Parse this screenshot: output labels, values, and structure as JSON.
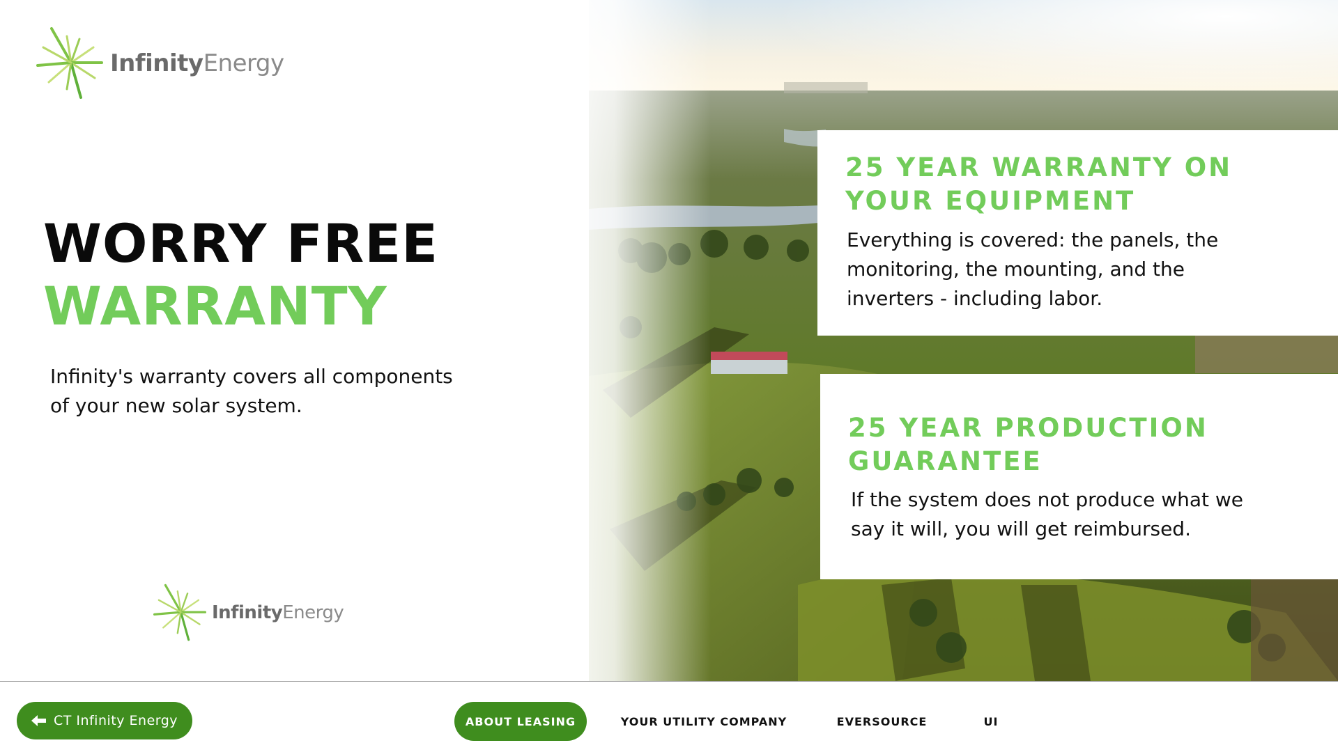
{
  "brand": {
    "logo_bold": "Infinity",
    "logo_light": "Energy",
    "accent_green": "#72cc5a",
    "button_green": "#3f8d1e"
  },
  "hero": {
    "headline_line1": "WORRY FREE",
    "headline_line2": "WARRANTY",
    "intro": "Infinity's warranty covers all components of your new solar system."
  },
  "cards": [
    {
      "title": "25 YEAR WARRANTY ON YOUR EQUIPMENT",
      "body": "Everything is covered: the panels, the monitoring, the mounting, and the inverters - including labor."
    },
    {
      "title": "25 YEAR PRODUCTION GUARANTEE",
      "body": "If the system does not produce what we say it will, you will get reimbursed."
    }
  ],
  "nav": {
    "back_label": "CT Infinity Energy",
    "back_icon": "arrow-left-icon",
    "items": [
      {
        "label": "ABOUT LEASING",
        "active": true
      },
      {
        "label": "YOUR UTILITY COMPANY",
        "active": false
      },
      {
        "label": "EVERSOURCE",
        "active": false
      },
      {
        "label": "UI",
        "active": false
      }
    ]
  },
  "photo": {
    "description_icon": "aerial-landscape-photo"
  }
}
